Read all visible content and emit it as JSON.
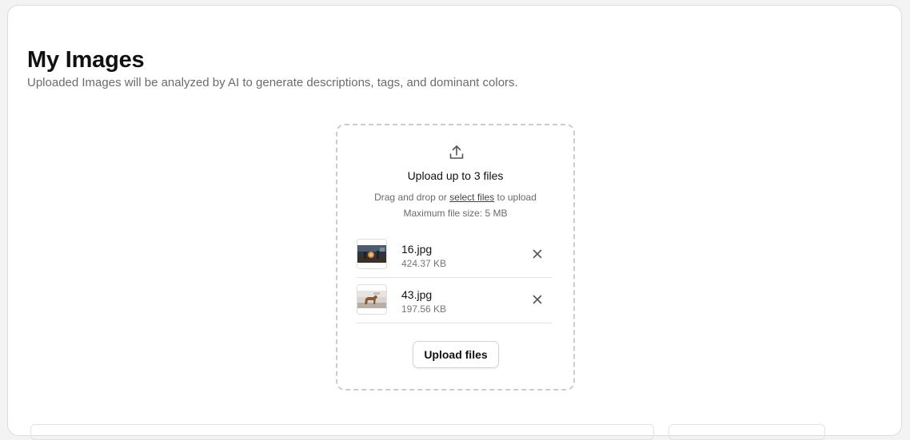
{
  "header": {
    "title": "My Images",
    "subtitle": "Uploaded Images will be analyzed by AI to generate descriptions, tags, and dominant colors."
  },
  "uploader": {
    "icon": "upload-icon",
    "heading": "Upload up to 3 files",
    "hint_prefix": "Drag and drop or ",
    "hint_link": "select files",
    "hint_suffix": " to upload",
    "max_size": "Maximum file size: 5 MB",
    "files": [
      {
        "name": "16.jpg",
        "size": "424.37 KB",
        "thumbnail": "fantasy-scene-thumbnail",
        "remove_icon": "close-icon"
      },
      {
        "name": "43.jpg",
        "size": "197.56 KB",
        "thumbnail": "dog-thumbnail",
        "remove_icon": "close-icon"
      }
    ],
    "upload_button": "Upload files"
  },
  "colors": {
    "page_background": "#ffffff",
    "text_primary": "#111111",
    "text_muted": "#6b6b6b",
    "dashed_border": "#cccccc"
  }
}
